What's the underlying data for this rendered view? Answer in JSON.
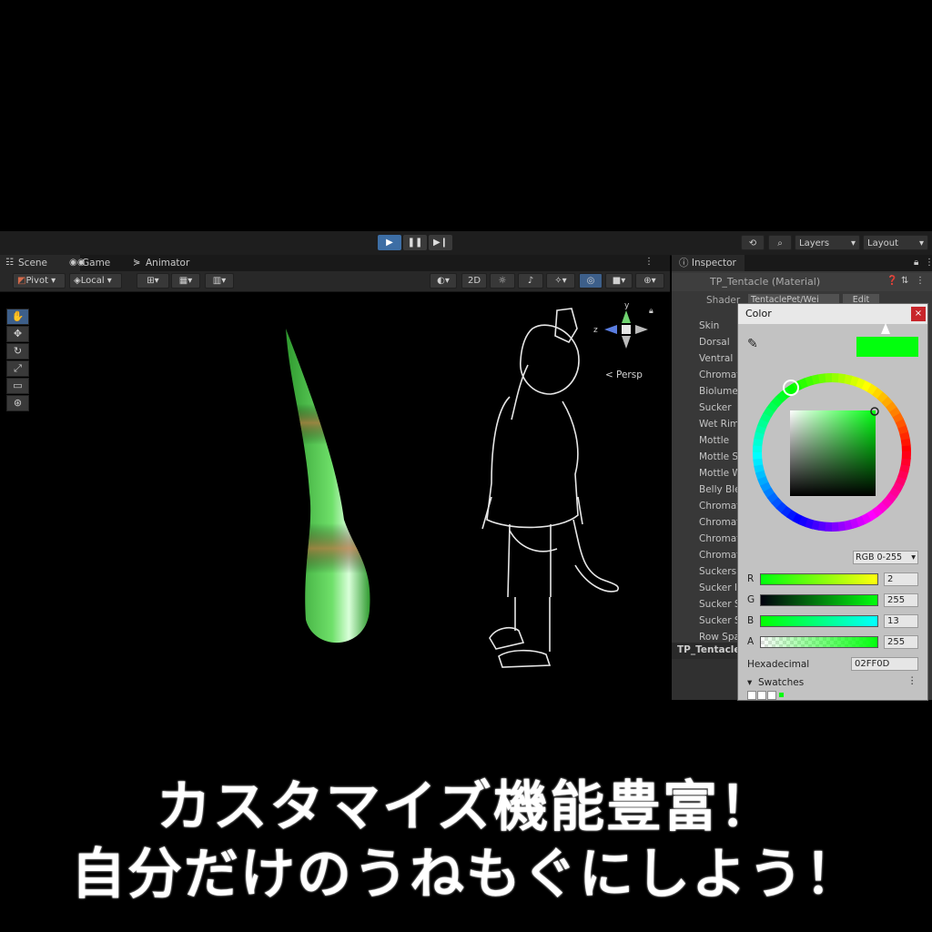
{
  "toolbar": {
    "play_icon": "play-icon",
    "pause_icon": "pause-icon",
    "step_icon": "step-icon",
    "layers_label": "Layers",
    "layout_label": "Layout"
  },
  "scene_tabs": [
    {
      "label": "Scene",
      "icon": "scene-icon"
    },
    {
      "label": "Game",
      "icon": "game-icon"
    },
    {
      "label": "Animator",
      "icon": "animator-icon"
    }
  ],
  "scene_toolbar": {
    "pivot_label": "Pivot",
    "local_label": "Local",
    "mode_2d_label": "2D"
  },
  "viewport": {
    "persp_label": "Persp",
    "gizmo_y": "y",
    "gizmo_z": "z"
  },
  "inspector": {
    "tab_label": "Inspector",
    "material_title": "TP_Tentacle (Material)",
    "shader_label": "Shader",
    "shader_value": "TentaclePet/Wei",
    "edit_label": "Edit",
    "properties": [
      "Skin",
      "Dorsal",
      "Ventral",
      "Chromat",
      "Biolume",
      "Sucker",
      "Wet Rim",
      "Mottle",
      "Mottle S",
      "Mottle W",
      "Belly Ble",
      "Chromat",
      "Chromat",
      "Chromat",
      "Chromat",
      "Suckers",
      "Sucker I",
      "Sucker S",
      "Sucker S",
      "Row Spa"
    ],
    "footer_label": "TP_Tentacle"
  },
  "color_picker": {
    "title": "Color",
    "current_color": "#02FF0D",
    "mode_label": "RGB 0-255",
    "channels": [
      {
        "label": "R",
        "value": "2"
      },
      {
        "label": "G",
        "value": "255"
      },
      {
        "label": "B",
        "value": "13"
      },
      {
        "label": "A",
        "value": "255"
      }
    ],
    "hex_label": "Hexadecimal",
    "hex_value": "02FF0D",
    "swatches_label": "Swatches"
  },
  "caption": {
    "line1": "カスタマイズ機能豊富！",
    "line2": "自分だけのうねもぐにしよう！"
  }
}
